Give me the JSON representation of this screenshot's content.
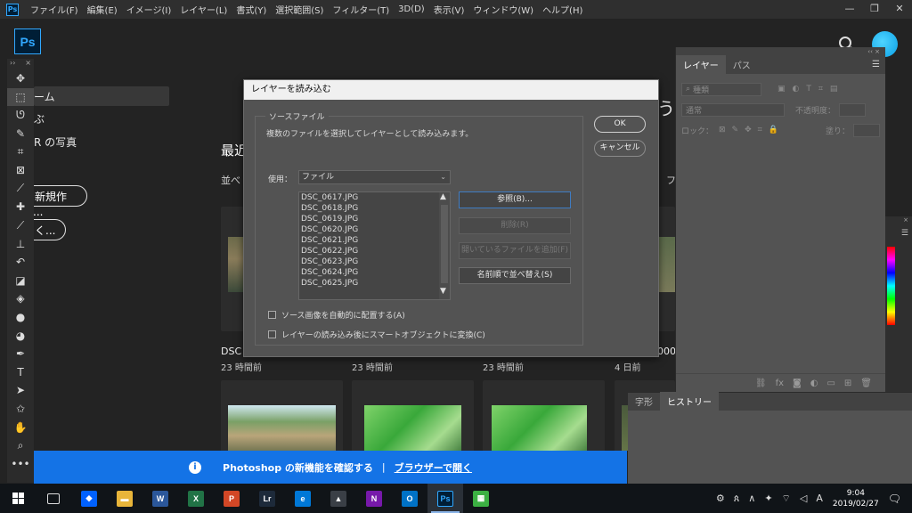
{
  "menubar": {
    "app_icon": "Ps",
    "items": [
      "ファイル(F)",
      "編集(E)",
      "イメージ(I)",
      "レイヤー(L)",
      "書式(Y)",
      "選択範囲(S)",
      "フィルター(T)",
      "3D(D)",
      "表示(V)",
      "ウィンドウ(W)",
      "ヘルプ(H)"
    ],
    "window_controls": [
      "minimize-icon",
      "restore-icon",
      "close-icon"
    ]
  },
  "appbar": {
    "logo": "Ps"
  },
  "toolbar": {
    "header": [
      "››",
      "×"
    ],
    "tools": [
      {
        "name": "move-tool",
        "glyph": "✥"
      },
      {
        "name": "marquee-tool",
        "glyph": "⬚",
        "active": true
      },
      {
        "name": "lasso-tool",
        "glyph": "ᘎ"
      },
      {
        "name": "quick-select-tool",
        "glyph": "✎"
      },
      {
        "name": "crop-tool",
        "glyph": "⌗"
      },
      {
        "name": "frame-tool",
        "glyph": "⊠"
      },
      {
        "name": "eyedropper-tool",
        "glyph": "⟋"
      },
      {
        "name": "healing-brush-tool",
        "glyph": "✚"
      },
      {
        "name": "brush-tool",
        "glyph": "⟋"
      },
      {
        "name": "stamp-tool",
        "glyph": "⊥"
      },
      {
        "name": "history-brush-tool",
        "glyph": "↶"
      },
      {
        "name": "eraser-tool",
        "glyph": "◪"
      },
      {
        "name": "paint-bucket-tool",
        "glyph": "◈"
      },
      {
        "name": "blur-tool",
        "glyph": "●"
      },
      {
        "name": "dodge-tool",
        "glyph": "◕"
      },
      {
        "name": "pen-tool",
        "glyph": "✒"
      },
      {
        "name": "type-tool",
        "glyph": "T"
      },
      {
        "name": "path-select-tool",
        "glyph": "➤"
      },
      {
        "name": "custom-shape-tool",
        "glyph": "✩"
      },
      {
        "name": "hand-tool",
        "glyph": "✋"
      },
      {
        "name": "zoom-tool",
        "glyph": "⌕"
      },
      {
        "name": "more-tools",
        "glyph": "•••"
      }
    ]
  },
  "home": {
    "nav": [
      "ーム",
      "ぶ",
      "R の写真"
    ],
    "buttons": [
      "新規作成...",
      "く..."
    ],
    "recent_title": "最近",
    "sort_label": "並べ",
    "right_fragment_1": "う",
    "right_fragment_2": "フ",
    "right_fragment_3": "000",
    "thumbs_row1": [
      {
        "name": "DSC",
        "time": "23 時間前"
      },
      {
        "name": "",
        "time": "23 時間前"
      },
      {
        "name": "",
        "time": "23 時間前"
      },
      {
        "name": "",
        "time": "4 日前"
      }
    ]
  },
  "layers_panel": {
    "collapse": "‹‹ ×",
    "tabs": [
      "レイヤー",
      "パス"
    ],
    "filter_placeholder": "種類",
    "blend_mode": "通常",
    "opacity_label": "不透明度：",
    "lock_label": "ロック：",
    "fill_label": "塗り："
  },
  "history_panel": {
    "tabs": [
      "字形",
      "ヒストリー"
    ]
  },
  "notification": {
    "text_a": "Photoshop の新機能を確認する",
    "separator": "|",
    "link": "ブラウザーで開く"
  },
  "dialog": {
    "title": "レイヤーを読み込む",
    "group_label": "ソースファイル",
    "description": "複数のファイルを選択してレイヤーとして読み込みます。",
    "use_label": "使用：",
    "use_value": "ファイル",
    "files": [
      "DSC_0617.JPG",
      "DSC_0618.JPG",
      "DSC_0619.JPG",
      "DSC_0620.JPG",
      "DSC_0621.JPG",
      "DSC_0622.JPG",
      "DSC_0623.JPG",
      "DSC_0624.JPG",
      "DSC_0625.JPG"
    ],
    "browse_button": "参照(B)...",
    "remove_button": "削除(R)",
    "add_open_button": "開いているファイルを追加(F)",
    "sort_button": "名前順で並べ替え(S)",
    "ok_button": "OK",
    "cancel_button": "キャンセル",
    "checkbox_align": "ソース画像を自動的に配置する(A)",
    "checkbox_smart": "レイヤーの読み込み後にスマートオブジェクトに変換(C)"
  },
  "taskbar": {
    "apps": [
      {
        "name": "task-view-icon",
        "label": "",
        "color": "#101418"
      },
      {
        "name": "dropbox-icon",
        "label": "◆",
        "color": "#0061fe"
      },
      {
        "name": "explorer-icon",
        "label": "▬",
        "color": "#e8b53a"
      },
      {
        "name": "word-icon",
        "label": "W",
        "color": "#2b579a"
      },
      {
        "name": "excel-icon",
        "label": "X",
        "color": "#217346"
      },
      {
        "name": "powerpoint-icon",
        "label": "P",
        "color": "#d24726"
      },
      {
        "name": "lightroom-icon",
        "label": "Lr",
        "color": "#1d2a3a"
      },
      {
        "name": "edge-icon",
        "label": "e",
        "color": "#0078d7"
      },
      {
        "name": "photos-icon",
        "label": "▲",
        "color": "#3a3f46"
      },
      {
        "name": "onenote-icon",
        "label": "N",
        "color": "#7719aa"
      },
      {
        "name": "outlook-icon",
        "label": "O",
        "color": "#0072c6"
      },
      {
        "name": "photoshop-icon",
        "label": "Ps",
        "color": "#001e36",
        "active": true
      },
      {
        "name": "image-viewer-icon",
        "label": "▦",
        "color": "#3cb043"
      }
    ],
    "tray_icons": [
      "⚙",
      "ጰ",
      "∧",
      "✦",
      "⌔",
      "◁",
      "A"
    ],
    "time": "9:04",
    "date": "2019/02/27"
  }
}
